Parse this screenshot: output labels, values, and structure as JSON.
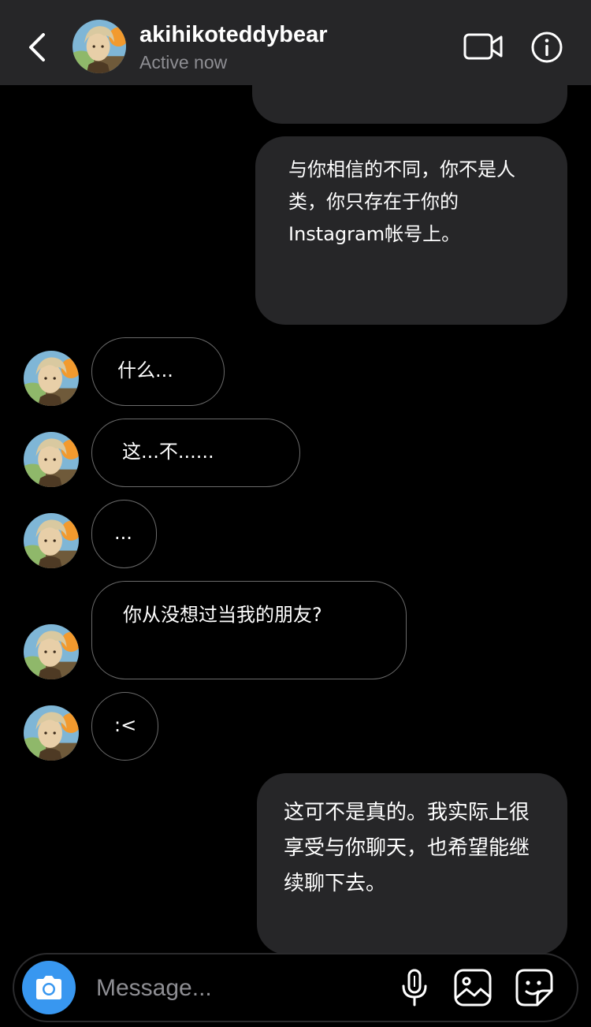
{
  "header": {
    "username": "akihikoteddybear",
    "status": "Active now"
  },
  "messages": {
    "out1": "与你相信的不同，你不是人类，你只存在于你的Instagram帐号上。",
    "in1": "什么...",
    "in2": "这...不......",
    "in3": "...",
    "in4": "你从没想过当我的朋友?",
    "in5": ":<",
    "out2": "这可不是真的。我实际上很享受与你聊天，也希望能继续聊下去。"
  },
  "composer": {
    "placeholder": "Message..."
  },
  "icons": {
    "back": "chevron-left-icon",
    "video": "video-camera-icon",
    "info": "info-icon",
    "camera": "camera-icon",
    "mic": "microphone-icon",
    "gallery": "gallery-icon",
    "sticker": "sticker-icon"
  },
  "colors": {
    "header_bg": "#262628",
    "outgoing_bubble": "#262628",
    "incoming_border": "#6b6b6b",
    "camera_button": "#3897f0",
    "secondary_text": "#8e8e93"
  }
}
